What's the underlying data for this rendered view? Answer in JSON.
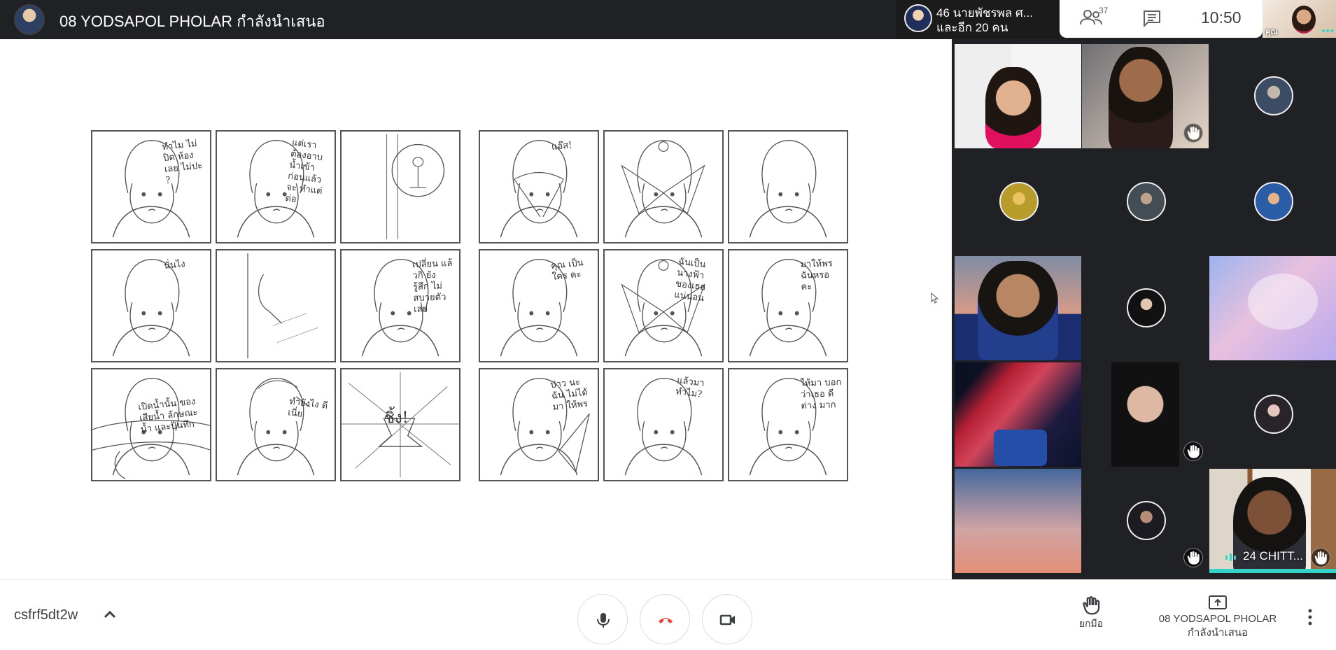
{
  "topbar": {
    "presenter_title": "08 YODSAPOL PHOLAR กำลังนำเสนอ",
    "raised_hands_line1": "46 นายพัชรพล ศ...",
    "raised_hands_line2": "และอีก 20 คน",
    "participant_count": "37",
    "clock": "10:50",
    "self_label": "คุณ",
    "self_dots": "•••"
  },
  "storyboard": {
    "panels": [
      {
        "text": "ทำไม ไม่ ปิด ห้องเลย ไม่ปะ ?"
      },
      {
        "text": "แต่เรา ต้องอาบน้ำเข้า ก่อนแล้วจะ ทำแต่ต่อ"
      },
      {
        "text": ""
      },
      {
        "text": "แอ๊ส!"
      },
      {
        "text": ""
      },
      {
        "text": ""
      },
      {
        "text": "นั่นไง"
      },
      {
        "text": ""
      },
      {
        "text": "เปลี่ยน แล้วกิ ยัง รู้สึก ไม่ สบายตัว เลย"
      },
      {
        "text": "คุณ เป็นใคร คะ"
      },
      {
        "text": "ฉันเป็น นางฟ้า ของเธอ แน่นอน"
      },
      {
        "text": "มาให้พร ฉันหรอ คะ"
      },
      {
        "text": "เปิดน้ำนั้น ของเสียน้ำ ลักษณะน้ำ และบันทึก"
      },
      {
        "text": "ทำยังไง ดีเนี่ย"
      },
      {
        "text": "ชิ้ง!"
      },
      {
        "text": "ป่าว นะฉัน ไม่ได้มา ให้พร"
      },
      {
        "text": "แล้วมา ทำไม?"
      },
      {
        "text": "ให้มา บอกว่าเธอ ดีต่าง มาก"
      }
    ]
  },
  "tiles": {
    "bottom_right_name": "24 CHITT..."
  },
  "bottombar": {
    "meeting_code": "csfrf5dt2w",
    "raise_hand_label": "ยกมือ",
    "presenter_name": "08 YODSAPOL PHOLAR",
    "presenter_status": "กำลังนำเสนอ"
  },
  "colors": {
    "topbar_bg": "#202124",
    "accent_teal": "#33d3c8",
    "end_call_red": "#ea4335",
    "grid_bg": "#202124"
  },
  "icons": {
    "people": "people-icon",
    "chat": "chat-icon",
    "mic": "mic-icon",
    "hangup": "hangup-icon",
    "camera": "camera-icon",
    "hand": "raise-hand-icon",
    "present": "present-icon",
    "more": "more-vert-icon"
  }
}
